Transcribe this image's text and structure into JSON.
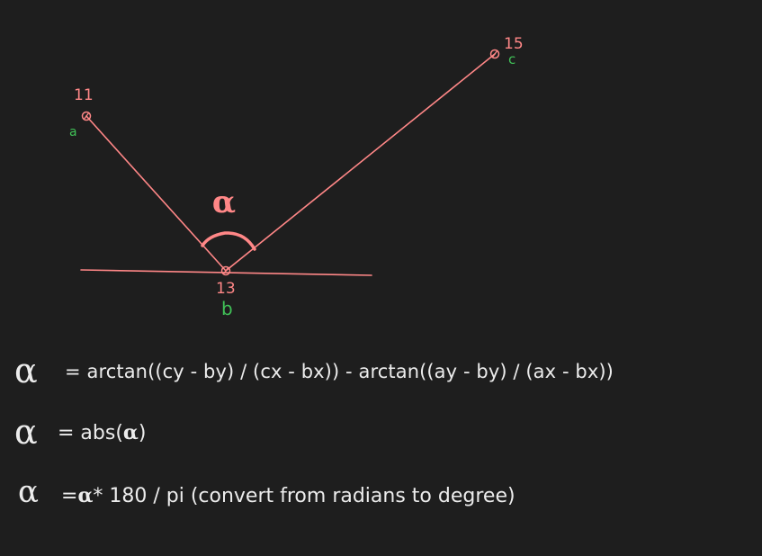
{
  "points": {
    "a": {
      "number": "11",
      "name": "a"
    },
    "b": {
      "number": "13",
      "name": "b"
    },
    "c": {
      "number": "15",
      "name": "c"
    }
  },
  "angle_symbol": "α",
  "formulas": {
    "line1": {
      "symbol": "α",
      "text": "= arctan((cy - by) / (cx - bx)) - arctan((ay - by) / (ax - bx))"
    },
    "line2": {
      "symbol": "α",
      "prefix": "= abs(",
      "inner_symbol": "α",
      "suffix": ")"
    },
    "line3": {
      "symbol": "α",
      "prefix": "=",
      "inner_symbol": "α",
      "suffix": "* 180 / pi (convert from radians to degree)"
    }
  },
  "colors": {
    "background": "#1e1e1e",
    "line": "#ff8787",
    "point_name": "#40c057",
    "text": "#ececec"
  }
}
